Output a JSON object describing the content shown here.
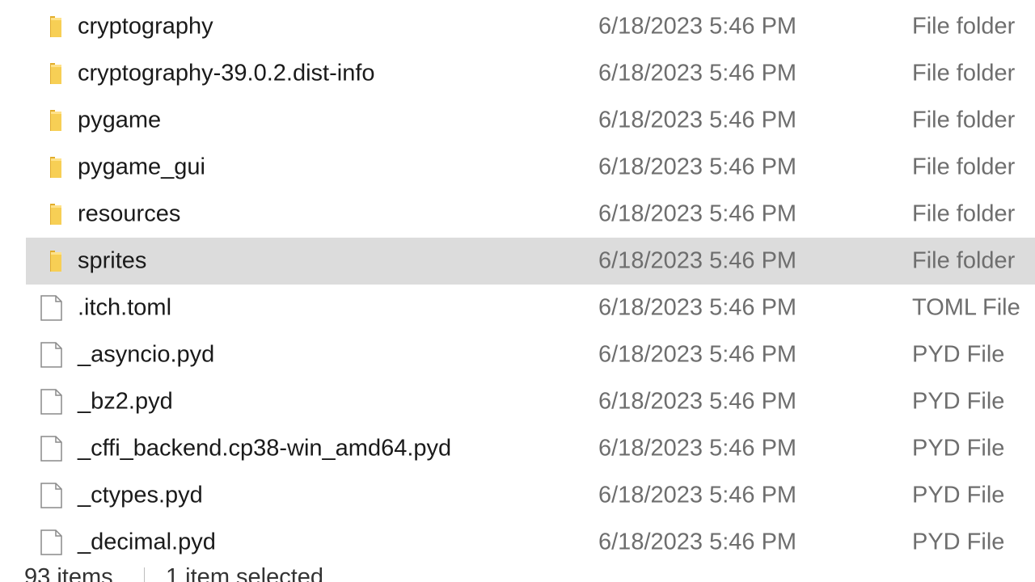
{
  "files": [
    {
      "name": "cryptography",
      "date": "6/18/2023 5:46 PM",
      "type": "File folder",
      "icon": "folder-icon"
    },
    {
      "name": "cryptography-39.0.2.dist-info",
      "date": "6/18/2023 5:46 PM",
      "type": "File folder",
      "icon": "folder-icon"
    },
    {
      "name": "pygame",
      "date": "6/18/2023 5:46 PM",
      "type": "File folder",
      "icon": "folder-icon"
    },
    {
      "name": "pygame_gui",
      "date": "6/18/2023 5:46 PM",
      "type": "File folder",
      "icon": "folder-icon"
    },
    {
      "name": "resources",
      "date": "6/18/2023 5:46 PM",
      "type": "File folder",
      "icon": "folder-icon"
    },
    {
      "name": "sprites",
      "date": "6/18/2023 5:46 PM",
      "type": "File folder",
      "icon": "folder-icon",
      "selected": true
    },
    {
      "name": ".itch.toml",
      "date": "6/18/2023 5:46 PM",
      "type": "TOML File",
      "icon": "file-icon"
    },
    {
      "name": "_asyncio.pyd",
      "date": "6/18/2023 5:46 PM",
      "type": "PYD File",
      "icon": "file-icon"
    },
    {
      "name": "_bz2.pyd",
      "date": "6/18/2023 5:46 PM",
      "type": "PYD File",
      "icon": "file-icon"
    },
    {
      "name": "_cffi_backend.cp38-win_amd64.pyd",
      "date": "6/18/2023 5:46 PM",
      "type": "PYD File",
      "icon": "file-icon"
    },
    {
      "name": "_ctypes.pyd",
      "date": "6/18/2023 5:46 PM",
      "type": "PYD File",
      "icon": "file-icon"
    },
    {
      "name": "_decimal.pyd",
      "date": "6/18/2023 5:46 PM",
      "type": "PYD File",
      "icon": "file-icon"
    }
  ],
  "status": {
    "item_count": "93 items",
    "selection": "1 item selected"
  },
  "colors": {
    "folder": "#f4c542",
    "selected_row": "#dcdcdc",
    "secondary_text": "#6e6e6e"
  }
}
